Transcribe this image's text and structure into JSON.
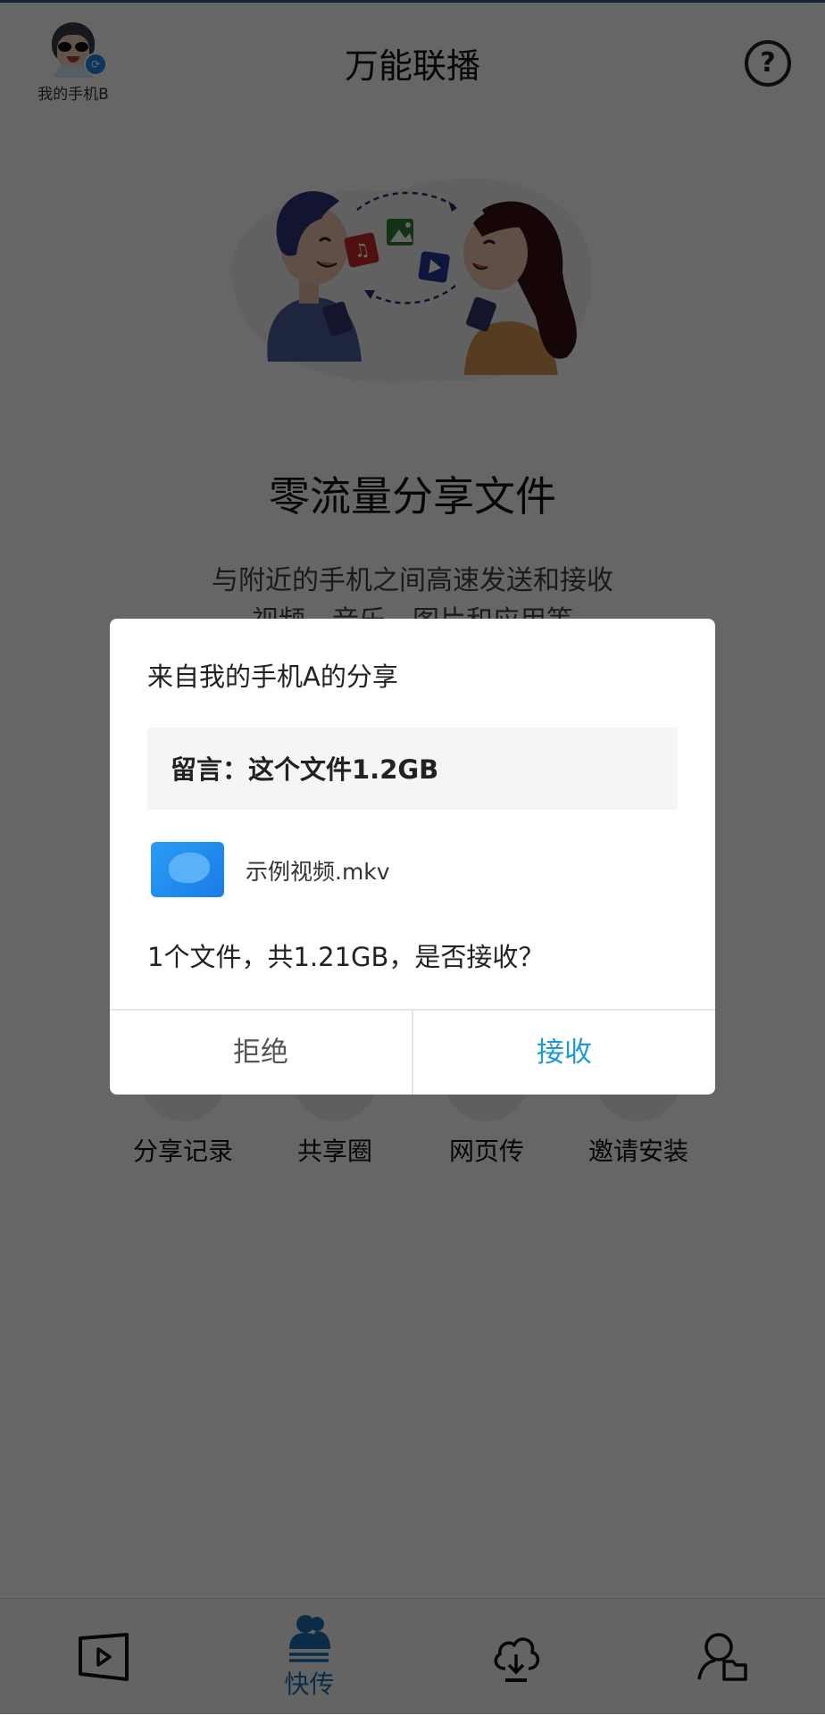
{
  "header": {
    "device_name": "我的手机B",
    "app_title": "万能联播",
    "help_label": "?"
  },
  "hero": {
    "title": "零流量分享文件",
    "subtitle_line1": "与附近的手机之间高速发送和接收",
    "subtitle_line2": "视频、音乐、图片和应用等"
  },
  "actions": [
    {
      "label": "分享记录",
      "icon": "history-icon"
    },
    {
      "label": "共享圈",
      "icon": "share-circle-icon"
    },
    {
      "label": "网页传",
      "icon": "web-transfer-icon"
    },
    {
      "label": "邀请安装",
      "icon": "invite-icon"
    }
  ],
  "dialog": {
    "title": "来自我的手机A的分享",
    "message": "留言：这个文件1.2GB",
    "file_name": "示例视频.mkv",
    "question": "1个文件，共1.21GB，是否接收？",
    "reject_label": "拒绝",
    "accept_label": "接收"
  },
  "bottom_nav": [
    {
      "label": "",
      "icon": "video-play-icon",
      "active": false
    },
    {
      "label": "快传",
      "icon": "quick-transfer-icon",
      "active": true
    },
    {
      "label": "",
      "icon": "cloud-download-icon",
      "active": false
    },
    {
      "label": "",
      "icon": "user-files-icon",
      "active": false
    }
  ],
  "colors": {
    "accent": "#1e9bd7",
    "nav_active": "#1a6fb0",
    "overlay": "rgba(0,0,0,0.60)",
    "file_icon": "#2a9df4"
  }
}
